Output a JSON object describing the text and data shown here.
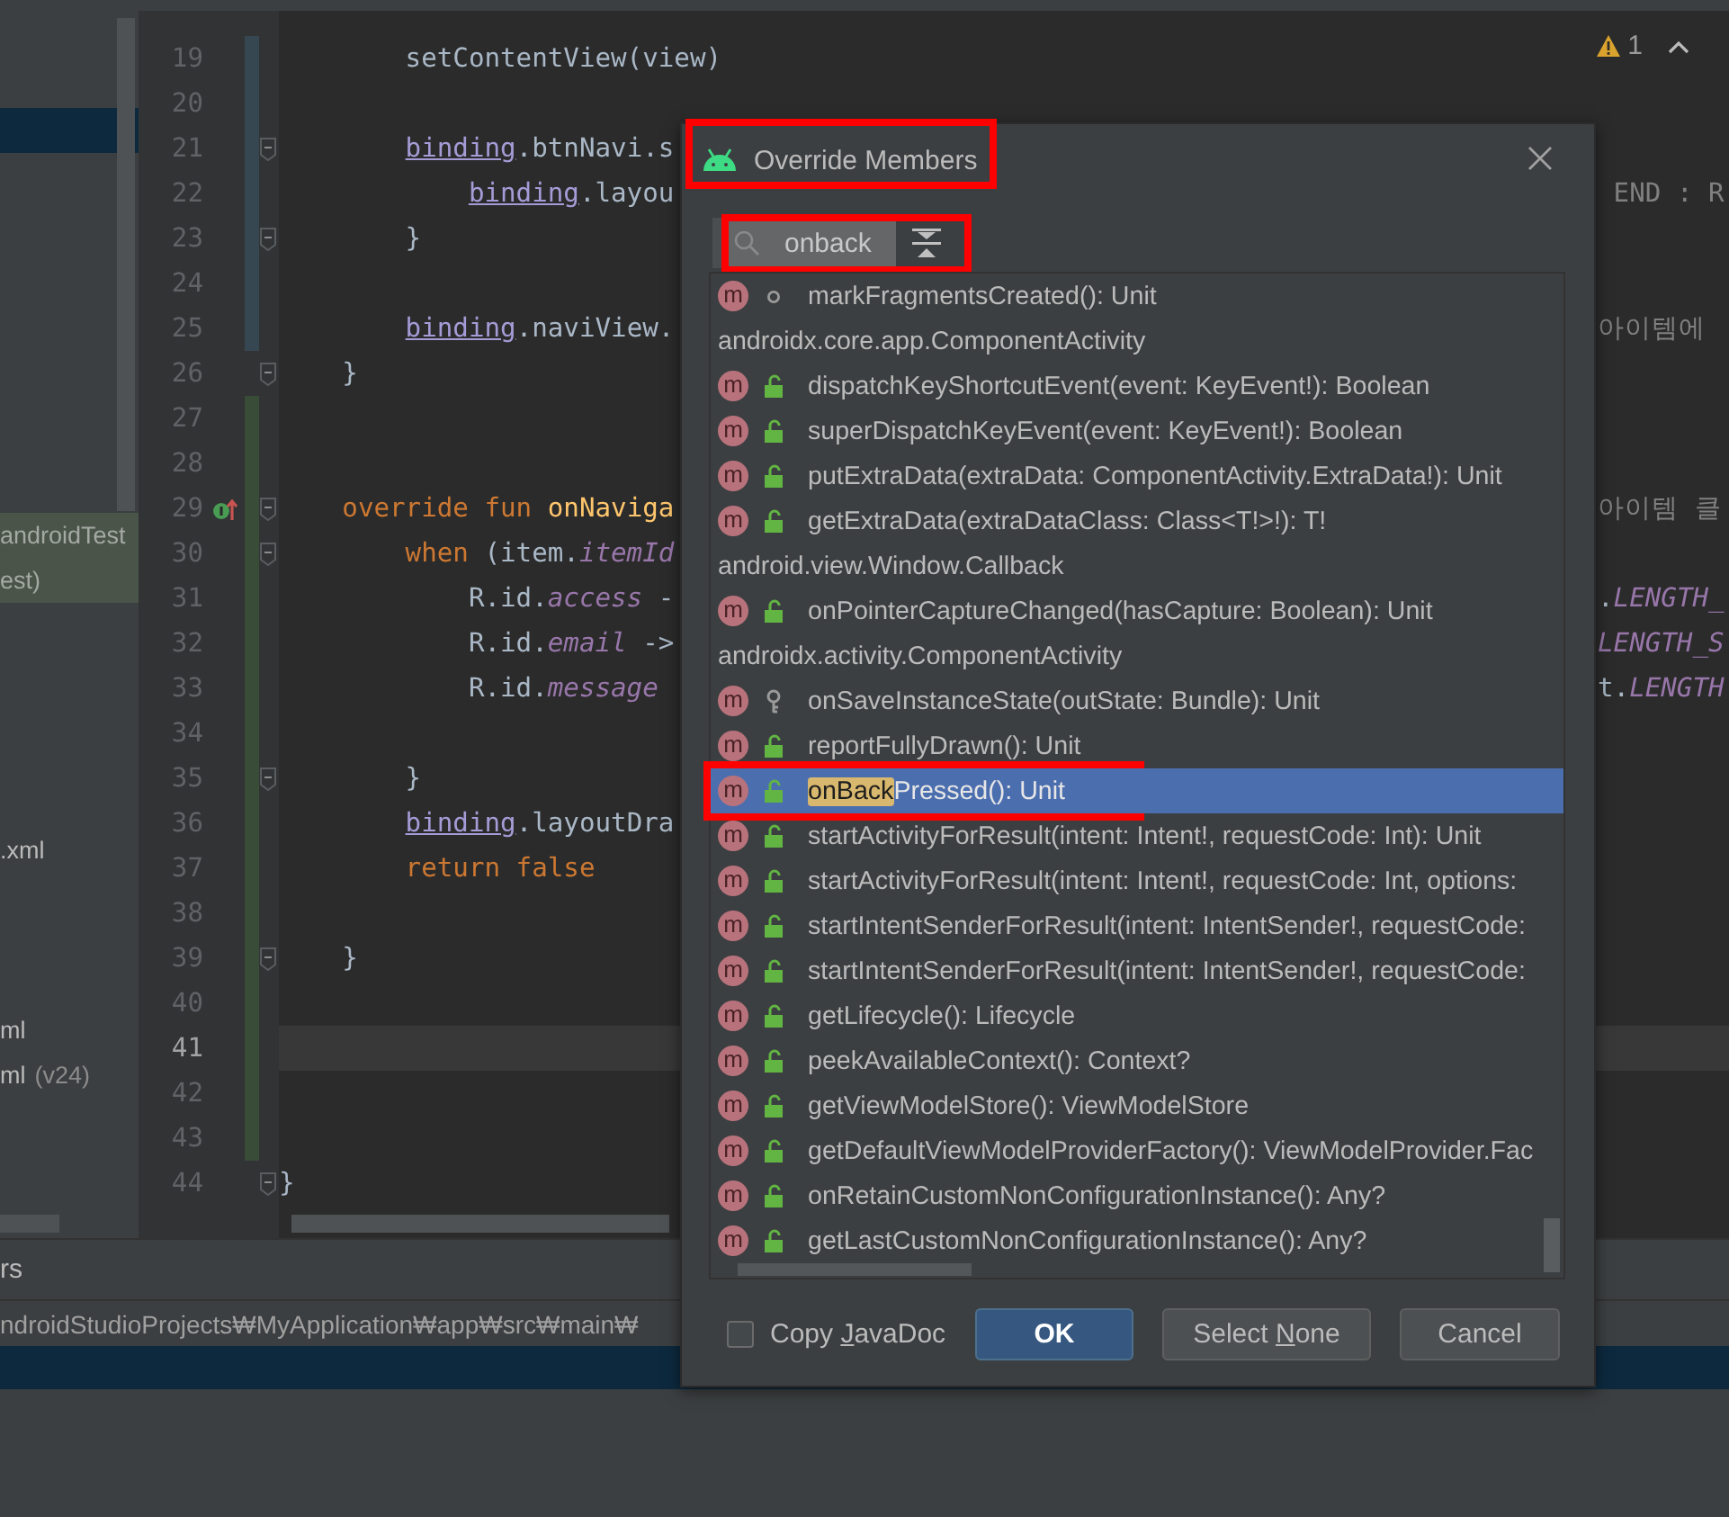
{
  "project_tree": {
    "rows": [
      {
        "selected": false
      },
      {
        "selected": false
      },
      {
        "selected": true
      },
      {
        "selected": false
      },
      {
        "selected": false
      },
      {
        "selected": false
      },
      {
        "selected": false
      },
      {
        "selected": false
      },
      {
        "selected": false
      },
      {
        "selected": false
      },
      {
        "selected": false
      },
      {
        "label": "androidTest",
        "kind": "test",
        "selected": false
      },
      {
        "label": "est)",
        "kind": "test",
        "selected": false
      },
      {
        "selected": false
      },
      {
        "selected": false
      },
      {
        "selected": false
      },
      {
        "selected": false
      },
      {
        "selected": false
      },
      {
        "label": ".xml",
        "kind": "file",
        "selected": false
      },
      {
        "selected": false
      },
      {
        "selected": false
      },
      {
        "selected": false
      },
      {
        "label": "ml",
        "kind": "file",
        "selected": false
      },
      {
        "label": "ml",
        "suffix": "(v24)",
        "kind": "file",
        "selected": false
      }
    ]
  },
  "editor": {
    "inspection": {
      "count": "1"
    },
    "lines": [
      {
        "number": "19",
        "modified": true,
        "added": false,
        "fold": false,
        "current": false,
        "override_marker": false,
        "code": [
          {
            "kind": "plain",
            "text": "        setContentView(view)"
          }
        ]
      },
      {
        "number": "20",
        "modified": true,
        "added": false,
        "fold": false,
        "current": false,
        "override_marker": false
      },
      {
        "number": "21",
        "modified": true,
        "added": false,
        "fold": true,
        "current": false,
        "override_marker": false,
        "code": [
          {
            "kind": "ref",
            "text": "        binding"
          },
          {
            "kind": "plain",
            "text": ".btnNavi.s"
          }
        ]
      },
      {
        "number": "22",
        "modified": true,
        "added": false,
        "fold": false,
        "current": false,
        "override_marker": false,
        "code": [
          {
            "kind": "ref",
            "text": "            binding"
          },
          {
            "kind": "plain",
            "text": ".layou"
          }
        ],
        "tail": [
          {
            "kind": "comment",
            "text": " END : R"
          }
        ]
      },
      {
        "number": "23",
        "modified": true,
        "added": false,
        "fold": true,
        "current": false,
        "override_marker": false,
        "code": [
          {
            "kind": "plain",
            "text": "        }"
          }
        ]
      },
      {
        "number": "24",
        "modified": true,
        "added": false,
        "fold": false,
        "current": false,
        "override_marker": false
      },
      {
        "number": "25",
        "modified": true,
        "added": false,
        "fold": false,
        "current": false,
        "override_marker": false,
        "code": [
          {
            "kind": "ref",
            "text": "        binding"
          },
          {
            "kind": "plain",
            "text": ".naviView."
          }
        ],
        "tail": [
          {
            "kind": "comment",
            "text": "아이템에"
          }
        ]
      },
      {
        "number": "26",
        "modified": false,
        "added": false,
        "fold": true,
        "current": false,
        "override_marker": false,
        "code": [
          {
            "kind": "plain",
            "text": "    }"
          }
        ]
      },
      {
        "number": "27",
        "modified": false,
        "added": true,
        "fold": false,
        "current": false,
        "override_marker": false
      },
      {
        "number": "28",
        "modified": false,
        "added": true,
        "fold": false,
        "current": false,
        "override_marker": false
      },
      {
        "number": "29",
        "modified": false,
        "added": true,
        "fold": true,
        "current": false,
        "override_marker": true,
        "code": [
          {
            "kind": "keyword",
            "text": "    override fun "
          },
          {
            "kind": "fn",
            "text": "onNaviga"
          }
        ],
        "tail": [
          {
            "kind": "comment",
            "text": "아이템 클"
          }
        ]
      },
      {
        "number": "30",
        "modified": false,
        "added": true,
        "fold": true,
        "current": false,
        "override_marker": false,
        "code": [
          {
            "kind": "keyword",
            "text": "        when "
          },
          {
            "kind": "plain",
            "text": "(item."
          },
          {
            "kind": "field",
            "text": "itemId"
          }
        ]
      },
      {
        "number": "31",
        "modified": false,
        "added": true,
        "fold": false,
        "current": false,
        "override_marker": false,
        "code": [
          {
            "kind": "plain",
            "text": "            R.id."
          },
          {
            "kind": "field",
            "text": "access"
          },
          {
            "kind": "plain",
            "text": " -"
          }
        ],
        "tail": [
          {
            "kind": "plain",
            "text": "."
          },
          {
            "kind": "field",
            "text": "LENGTH_"
          }
        ]
      },
      {
        "number": "32",
        "modified": false,
        "added": true,
        "fold": false,
        "current": false,
        "override_marker": false,
        "code": [
          {
            "kind": "plain",
            "text": "            R.id."
          },
          {
            "kind": "field",
            "text": "email"
          },
          {
            "kind": "plain",
            "text": " ->"
          }
        ],
        "tail": [
          {
            "kind": "field",
            "text": "LENGTH_S"
          }
        ]
      },
      {
        "number": "33",
        "modified": false,
        "added": true,
        "fold": false,
        "current": false,
        "override_marker": false,
        "code": [
          {
            "kind": "plain",
            "text": "            R.id."
          },
          {
            "kind": "field",
            "text": "message"
          }
        ],
        "tail": [
          {
            "kind": "plain",
            "text": "t."
          },
          {
            "kind": "field",
            "text": "LENGTH"
          }
        ]
      },
      {
        "number": "34",
        "modified": false,
        "added": true,
        "fold": false,
        "current": false,
        "override_marker": false
      },
      {
        "number": "35",
        "modified": false,
        "added": true,
        "fold": true,
        "current": false,
        "override_marker": false,
        "code": [
          {
            "kind": "plain",
            "text": "        }"
          }
        ]
      },
      {
        "number": "36",
        "modified": false,
        "added": true,
        "fold": false,
        "current": false,
        "override_marker": false,
        "code": [
          {
            "kind": "ref",
            "text": "        binding"
          },
          {
            "kind": "plain",
            "text": ".layoutDra"
          }
        ]
      },
      {
        "number": "37",
        "modified": false,
        "added": true,
        "fold": false,
        "current": false,
        "override_marker": false,
        "code": [
          {
            "kind": "keyword",
            "text": "        return false"
          }
        ]
      },
      {
        "number": "38",
        "modified": false,
        "added": true,
        "fold": false,
        "current": false,
        "override_marker": false
      },
      {
        "number": "39",
        "modified": false,
        "added": true,
        "fold": true,
        "current": false,
        "override_marker": false,
        "code": [
          {
            "kind": "plain",
            "text": "    }"
          }
        ]
      },
      {
        "number": "40",
        "modified": false,
        "added": true,
        "fold": false,
        "current": false,
        "override_marker": false
      },
      {
        "number": "41",
        "modified": false,
        "added": true,
        "fold": false,
        "current": true,
        "override_marker": false
      },
      {
        "number": "42",
        "modified": false,
        "added": true,
        "fold": false,
        "current": false,
        "override_marker": false
      },
      {
        "number": "43",
        "modified": false,
        "added": true,
        "fold": false,
        "current": false,
        "override_marker": false
      },
      {
        "number": "44",
        "modified": false,
        "added": false,
        "fold": true,
        "current": false,
        "override_marker": false,
        "code": [
          {
            "kind": "plain",
            "text": "}"
          }
        ]
      }
    ]
  },
  "bottom_panel": {
    "tool_tab": "rs",
    "path": "ndroidStudioProjects₩MyApplication₩app₩src₩main₩"
  },
  "dialog": {
    "title": "Override Members",
    "title_annotated": true,
    "search": {
      "value": "onback",
      "annotated": true
    },
    "items": [
      {
        "kind": "method",
        "icon": "m",
        "public": false,
        "protected": false,
        "text": "markFragmentsCreated(): Unit",
        "selected": false
      },
      {
        "kind": "group",
        "text": "androidx.core.app.ComponentActivity"
      },
      {
        "kind": "method",
        "icon": "m",
        "public": true,
        "protected": false,
        "text": "dispatchKeyShortcutEvent(event: KeyEvent!): Boolean",
        "selected": false
      },
      {
        "kind": "method",
        "icon": "m",
        "public": true,
        "protected": false,
        "text": "superDispatchKeyEvent(event: KeyEvent!): Boolean",
        "selected": false
      },
      {
        "kind": "method",
        "icon": "m",
        "public": true,
        "protected": false,
        "text": "putExtraData(extraData: ComponentActivity.ExtraData!): Unit",
        "selected": false
      },
      {
        "kind": "method",
        "icon": "m",
        "public": true,
        "protected": false,
        "text": "getExtraData(extraDataClass: Class<T!>!): T!",
        "selected": false
      },
      {
        "kind": "group",
        "text": "android.view.Window.Callback"
      },
      {
        "kind": "method",
        "icon": "m",
        "public": true,
        "protected": false,
        "text": "onPointerCaptureChanged(hasCapture: Boolean): Unit",
        "selected": false
      },
      {
        "kind": "group",
        "text": "androidx.activity.ComponentActivity"
      },
      {
        "kind": "method",
        "icon": "m",
        "public": false,
        "protected": true,
        "text": "onSaveInstanceState(outState: Bundle): Unit",
        "selected": false
      },
      {
        "kind": "method",
        "icon": "m",
        "public": true,
        "protected": false,
        "text": "reportFullyDrawn(): Unit",
        "selected": false
      },
      {
        "kind": "method",
        "icon": "m",
        "public": true,
        "protected": false,
        "match": "onBack",
        "text": "Pressed(): Unit",
        "selected": true,
        "annotated": true
      },
      {
        "kind": "method",
        "icon": "m",
        "public": true,
        "protected": false,
        "text": "startActivityForResult(intent: Intent!, requestCode: Int): Unit",
        "selected": false
      },
      {
        "kind": "method",
        "icon": "m",
        "public": true,
        "protected": false,
        "text": "startActivityForResult(intent: Intent!, requestCode: Int, options:",
        "selected": false
      },
      {
        "kind": "method",
        "icon": "m",
        "public": true,
        "protected": false,
        "text": "startIntentSenderForResult(intent: IntentSender!, requestCode:",
        "selected": false
      },
      {
        "kind": "method",
        "icon": "m",
        "public": true,
        "protected": false,
        "text": "startIntentSenderForResult(intent: IntentSender!, requestCode:",
        "selected": false
      },
      {
        "kind": "method",
        "icon": "m",
        "public": true,
        "protected": false,
        "text": "getLifecycle(): Lifecycle",
        "selected": false
      },
      {
        "kind": "method",
        "icon": "m",
        "public": true,
        "protected": false,
        "text": "peekAvailableContext(): Context?",
        "selected": false
      },
      {
        "kind": "method",
        "icon": "m",
        "public": true,
        "protected": false,
        "text": "getViewModelStore(): ViewModelStore",
        "selected": false
      },
      {
        "kind": "method",
        "icon": "m",
        "public": true,
        "protected": false,
        "text": "getDefaultViewModelProviderFactory(): ViewModelProvider.Fac",
        "selected": false
      },
      {
        "kind": "method",
        "icon": "m",
        "public": true,
        "protected": false,
        "text": "onRetainCustomNonConfigurationInstance(): Any?",
        "selected": false
      },
      {
        "kind": "method",
        "icon": "m",
        "public": true,
        "protected": false,
        "text": "getLastCustomNonConfigurationInstance(): Any?",
        "selected": false
      }
    ],
    "copy_javadoc": {
      "label": [
        "Copy ",
        "J",
        "avaDoc"
      ],
      "checked": false
    },
    "buttons": [
      {
        "label": [
          "OK"
        ],
        "default": true
      },
      {
        "label": [
          "Select ",
          "N",
          "one"
        ],
        "default": false
      },
      {
        "label": [
          "Cancel"
        ],
        "default": false
      }
    ]
  }
}
